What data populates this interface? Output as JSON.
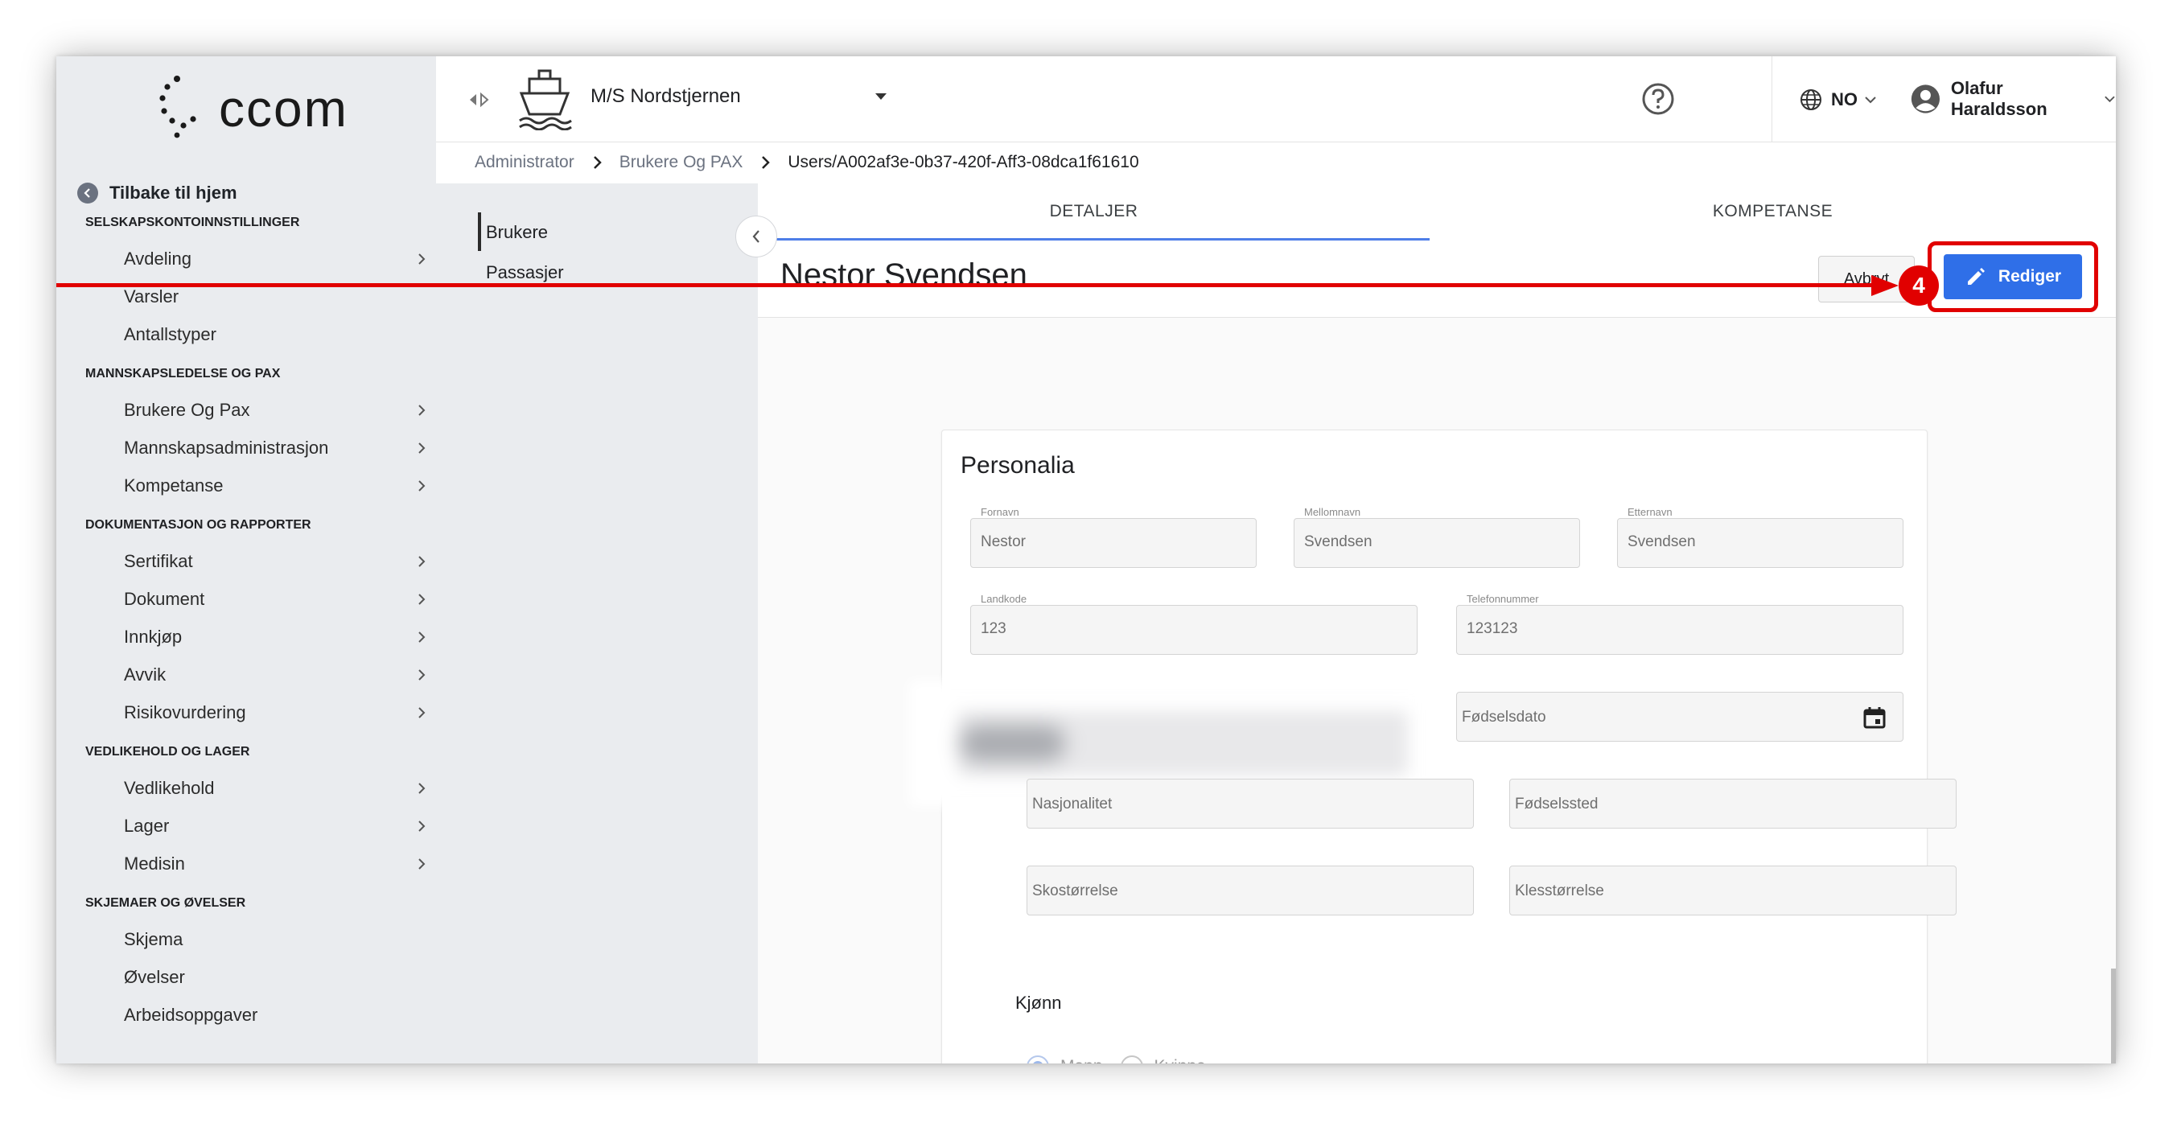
{
  "app": {
    "logo_text": "ccom"
  },
  "sidebar": {
    "back_label": "Tilbake til hjem",
    "sections": [
      {
        "title": "SELSKAPSKONTOINNSTILLINGER"
      },
      {
        "title": "MANNSKAPSLEDELSE OG PAX"
      },
      {
        "title": "DOKUMENTASJON OG RAPPORTER"
      },
      {
        "title": "VEDLIKEHOLD OG LAGER"
      },
      {
        "title": "SKJEMAER OG ØVELSER"
      }
    ],
    "items": [
      {
        "label": "Avdeling"
      },
      {
        "label": "Varsler"
      },
      {
        "label": "Antallstyper"
      },
      {
        "label": "Brukere Og Pax"
      },
      {
        "label": "Mannskapsadministrasjon"
      },
      {
        "label": "Kompetanse"
      },
      {
        "label": "Sertifikat"
      },
      {
        "label": "Dokument"
      },
      {
        "label": "Innkjøp"
      },
      {
        "label": "Avvik"
      },
      {
        "label": "Risikovurdering"
      },
      {
        "label": "Vedlikehold"
      },
      {
        "label": "Lager"
      },
      {
        "label": "Medisin"
      },
      {
        "label": "Skjema"
      },
      {
        "label": "Øvelser"
      },
      {
        "label": "Arbeidsoppgaver"
      }
    ]
  },
  "topbar": {
    "vessel_name": "M/S Nordstjernen",
    "language": "NO",
    "user_name": "Olafur Haraldsson"
  },
  "breadcrumb": {
    "items": [
      "Administrator",
      "Brukere Og PAX",
      "Users/A002af3e-0b37-420f-Aff3-08dca1f61610"
    ]
  },
  "subnav": {
    "items": [
      {
        "label": "Brukere"
      },
      {
        "label": "Passasjer"
      }
    ]
  },
  "tabs": [
    {
      "label": "DETALJER"
    },
    {
      "label": "KOMPETANSE"
    }
  ],
  "detail": {
    "title": "Nestor Svendsen",
    "cancel_label": "Avbryt",
    "edit_label": "Rediger"
  },
  "annotation": {
    "step": "4",
    "color": "#e10000"
  },
  "form": {
    "title": "Personalia",
    "first_name": {
      "label": "Fornavn",
      "value": "Nestor"
    },
    "middle_name": {
      "label": "Mellomnavn",
      "value": "Svendsen"
    },
    "last_name": {
      "label": "Etternavn",
      "value": "Svendsen"
    },
    "country_code": {
      "label": "Landkode",
      "value": "123"
    },
    "phone": {
      "label": "Telefonnummer",
      "value": "123123"
    },
    "birth_date": {
      "placeholder": "Fødselsdato"
    },
    "nationality": {
      "placeholder": "Nasjonalitet"
    },
    "birth_place": {
      "placeholder": "Fødselssted"
    },
    "shoe_size": {
      "placeholder": "Skostørrelse"
    },
    "clothing_size": {
      "placeholder": "Klesstørrelse"
    },
    "gender": {
      "label": "Kjønn",
      "options": [
        {
          "label": "Mann",
          "selected": true
        },
        {
          "label": "Kvinne",
          "selected": false
        }
      ]
    }
  },
  "colors": {
    "accent": "#2f6fe8",
    "sidebar_bg": "#eaecef",
    "tab_underline": "#4e7ee8"
  }
}
